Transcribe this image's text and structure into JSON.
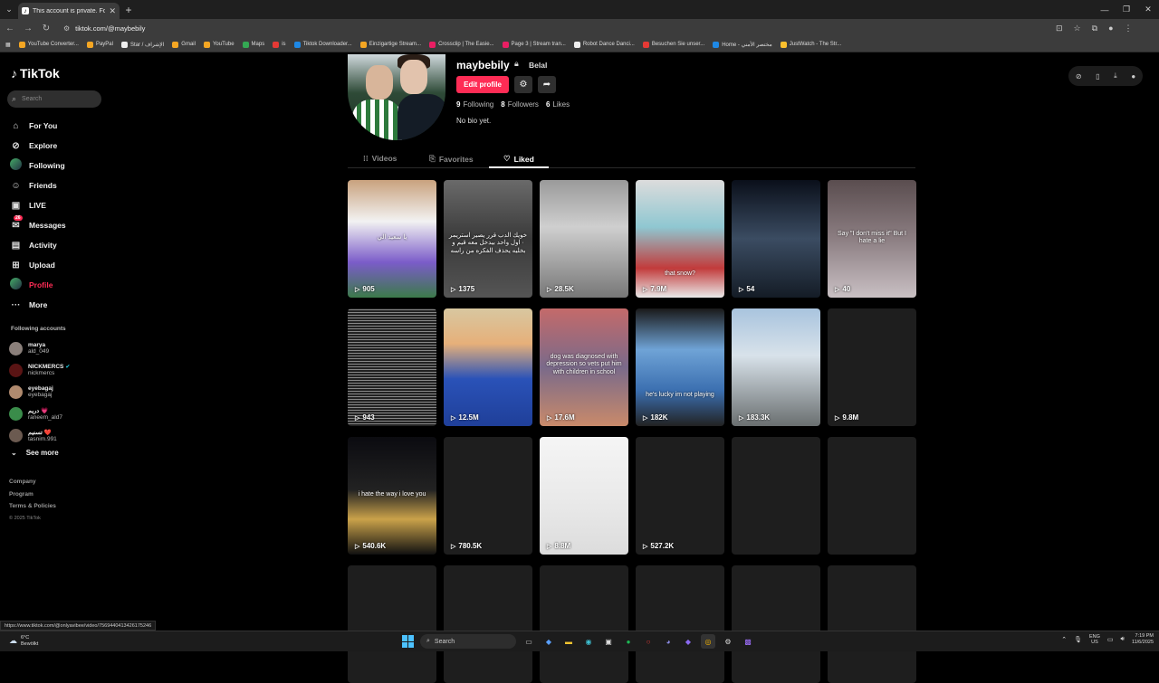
{
  "browser": {
    "tab_title": "This account is private. Follow t",
    "url": "tiktok.com/@maybebily",
    "bookmarks": [
      {
        "label": "YouTube Converter...",
        "color": "#f4a623"
      },
      {
        "label": "PayPal",
        "color": "#f4a623"
      },
      {
        "label": "Star / الإشراف",
        "color": "#eee"
      },
      {
        "label": "Gmail",
        "color": "#f4a623"
      },
      {
        "label": "YouTube",
        "color": "#f4a623"
      },
      {
        "label": "Maps",
        "color": "#34a853"
      },
      {
        "label": "is",
        "color": "#e53935"
      },
      {
        "label": "Tiktok Downloader...",
        "color": "#1e88e5"
      },
      {
        "label": "Einzigartige Stream...",
        "color": "#f4a623"
      },
      {
        "label": "Crossclip | The Easie...",
        "color": "#e91e63"
      },
      {
        "label": "Page 3 | Stream tran...",
        "color": "#e91e63"
      },
      {
        "label": "Robot Dance Danci...",
        "color": "#eee"
      },
      {
        "label": "Besuchen Sie unser...",
        "color": "#e53935"
      },
      {
        "label": "Home - مختصر الأمني",
        "color": "#1e88e5"
      },
      {
        "label": "JustWatch - The Str...",
        "color": "#fbc02d"
      }
    ],
    "status_url": "https://www.tiktok.com/@onlyavibee/video/7569440413426175246"
  },
  "sidebar": {
    "logo": "TikTok",
    "search_placeholder": "Search",
    "nav": [
      {
        "label": "For You",
        "icon": "home-icon",
        "glyph": "⌂"
      },
      {
        "label": "Explore",
        "icon": "compass-icon",
        "glyph": "⊘"
      },
      {
        "label": "Following",
        "icon": "following-avatar-icon",
        "glyph": ""
      },
      {
        "label": "Friends",
        "icon": "friends-icon",
        "glyph": "☺"
      },
      {
        "label": "LIVE",
        "icon": "live-icon",
        "glyph": "▣"
      },
      {
        "label": "Messages",
        "icon": "messages-icon",
        "glyph": "✉",
        "badge": "26"
      },
      {
        "label": "Activity",
        "icon": "activity-icon",
        "glyph": "▤"
      },
      {
        "label": "Upload",
        "icon": "upload-icon",
        "glyph": "⊞"
      },
      {
        "label": "Profile",
        "icon": "profile-avatar-icon",
        "glyph": ""
      },
      {
        "label": "More",
        "icon": "more-icon",
        "glyph": "···"
      }
    ],
    "following_label": "Following accounts",
    "following": [
      {
        "name": "marya",
        "handle": "ald_049",
        "color": "#8a7f7a"
      },
      {
        "name": "NICKMERCS",
        "handle": "nickmercs",
        "color": "#5a1414",
        "verified": true
      },
      {
        "name": "eyebagaj",
        "handle": "eyebagaj",
        "color": "#b08a6e"
      },
      {
        "name": "دريم 💗",
        "handle": "raneem_ald7",
        "color": "#3a8c4a"
      },
      {
        "name": "تسنيم ❤️",
        "handle": "tasnim.991",
        "color": "#6b5a50"
      }
    ],
    "see_more": "See more",
    "footer": [
      "Company",
      "Program",
      "Terms & Policies"
    ],
    "copyright": "© 2025 TikTok"
  },
  "profile": {
    "username": "maybebily",
    "nickname": "Belal",
    "edit_label": "Edit profile",
    "stats": [
      {
        "num": "9",
        "label": "Following"
      },
      {
        "num": "8",
        "label": "Followers"
      },
      {
        "num": "6",
        "label": "Likes"
      }
    ],
    "bio": "No bio yet.",
    "tabs": [
      "Videos",
      "Favorites",
      "Liked"
    ]
  },
  "videos": [
    {
      "views": "905",
      "bg": "linear-gradient(180deg,#c9a27e 0%,#f2f2f2 35%,#7b5cc9 70%,#3c7a4a 100%)",
      "text": "يا سعيد الي",
      "text_top": "60px"
    },
    {
      "views": "1375",
      "bg": "linear-gradient(180deg,#6a6a6a 0%,#3a3a3a 50%,#555 100%)",
      "text": "خويك الدب قرر يصير استريمر · اول واحد بيدخل معه قيم و بخليه يحذف الفكره من راسه",
      "text_top": "58px"
    },
    {
      "views": "28.5K",
      "bg": "linear-gradient(180deg,#9a9a9a 0%,#cfcfcf 40%,#777 100%)",
      "text": "",
      "text_top": "0"
    },
    {
      "views": "7.9M",
      "bg": "linear-gradient(180deg,#dcdcdc 0%,#8fc7d1 40%,#c23b3b 75%,#e9e9e9 100%)",
      "text": "that snow?",
      "text_top": "100px"
    },
    {
      "views": "54",
      "bg": "linear-gradient(180deg,#0a0f1a 0%,#3b4c62 50%,#141c26 100%)",
      "text": "",
      "text_top": "0"
    },
    {
      "views": "40",
      "bg": "linear-gradient(180deg,#5a4d4f 0%,#8c7e82 50%,#c9c0c3 100%)",
      "text": "Say \"I don't miss it\" But I hate a lie",
      "text_top": "56px"
    },
    {
      "views": "943",
      "bg": "repeating-linear-gradient(0deg,#222 0 2px,#888 2px 3px)",
      "text": "",
      "text_top": "0"
    },
    {
      "views": "12.5M",
      "bg": "linear-gradient(180deg,#d8c7a0 0%,#e6b07a 30%,#2a52b8 60%,#1f3f99 100%)",
      "text": "",
      "text_top": "0"
    },
    {
      "views": "17.6M",
      "bg": "linear-gradient(180deg,#c46a6a 0%,#7a6a8a 50%,#c98a6a 100%)",
      "text": "dog was diagnosed with depression so vets put him with children in school",
      "text_top": "50px"
    },
    {
      "views": "182K",
      "bg": "linear-gradient(180deg,#1a1a1a 0%,#6fa3d6 35%,#3b6fb0 70%,#222 100%)",
      "text": "he's lucky im not playing",
      "text_top": "92px"
    },
    {
      "views": "183.3K",
      "bg": "linear-gradient(180deg,#a9c4de 0%,#d8e2ea 40%,#6a6f70 100%)",
      "text": "",
      "text_top": "0"
    },
    {
      "views": "9.8M",
      "bg": "#1e1e1e",
      "text": "",
      "text_top": "0"
    },
    {
      "views": "540.6K",
      "bg": "linear-gradient(180deg,#0b0b10 0%,#222 45%,#caa24a 70%,#111 100%)",
      "text": "i hate the way i love you",
      "text_top": "60px"
    },
    {
      "views": "780.5K",
      "bg": "#1e1e1e",
      "text": "",
      "text_top": "0"
    },
    {
      "views": "8.8M",
      "bg": "linear-gradient(180deg,#f5f5f5 0%,#e8e8e8 60%,#dcdcdc 100%)",
      "text": "",
      "text_top": "0"
    },
    {
      "views": "527.2K",
      "bg": "#1e1e1e",
      "text": "",
      "text_top": "0"
    },
    {
      "views": "",
      "bg": "#1e1e1e",
      "text": "",
      "text_top": "0"
    },
    {
      "views": "",
      "bg": "#1e1e1e",
      "text": "",
      "text_top": "0"
    },
    {
      "views": "",
      "bg": "#1e1e1e",
      "text": "",
      "text_top": "0"
    },
    {
      "views": "",
      "bg": "#1e1e1e",
      "text": "",
      "text_top": "0"
    },
    {
      "views": "",
      "bg": "#1e1e1e",
      "text": "",
      "text_top": "0"
    },
    {
      "views": "",
      "bg": "#1e1e1e",
      "text": "",
      "text_top": "0"
    },
    {
      "views": "",
      "bg": "#1e1e1e",
      "text": "",
      "text_top": "0"
    },
    {
      "views": "",
      "bg": "#1e1e1e",
      "text": "",
      "text_top": "0"
    }
  ],
  "taskbar": {
    "weather_temp": "6°C",
    "weather_desc": "Bewölkt",
    "search": "Search",
    "lang1": "ENG",
    "lang2": "US",
    "time": "7:19 PM",
    "date": "11/6/2025"
  }
}
